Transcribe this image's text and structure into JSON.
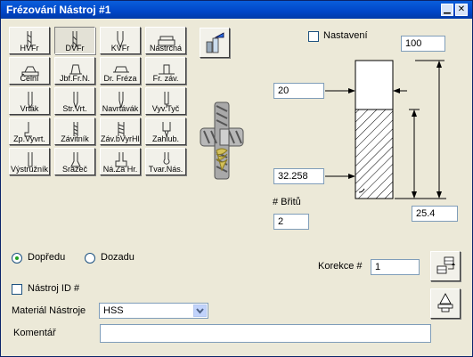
{
  "window": {
    "title": "Frézování Nástroj #1"
  },
  "tool_buttons": [
    {
      "label": "HVFr",
      "pressed": false
    },
    {
      "label": "DVFr",
      "pressed": true
    },
    {
      "label": "KVFr",
      "pressed": false
    },
    {
      "label": "Nástrčná",
      "pressed": false
    },
    {
      "label": "Čelní",
      "pressed": false
    },
    {
      "label": "Jbf.Fr.N.",
      "pressed": false
    },
    {
      "label": "Dr. Fréza",
      "pressed": false
    },
    {
      "label": "Fr. záv.",
      "pressed": false
    },
    {
      "label": "Vrták",
      "pressed": false
    },
    {
      "label": "Str.Vrt.",
      "pressed": false
    },
    {
      "label": "Navrtávák",
      "pressed": false
    },
    {
      "label": "Vyv.Tyč",
      "pressed": false
    },
    {
      "label": "Zp.Vyvrt.",
      "pressed": false
    },
    {
      "label": "Závitník",
      "pressed": false
    },
    {
      "label": "Záv.bVyrHlav",
      "pressed": false
    },
    {
      "label": "Zahlub.",
      "pressed": false
    },
    {
      "label": "Výstružník",
      "pressed": false
    },
    {
      "label": "Srážeč",
      "pressed": false
    },
    {
      "label": "Ná.Za Hr.",
      "pressed": false
    },
    {
      "label": "Tvar.Nás.",
      "pressed": false
    }
  ],
  "nastaveni": {
    "label": "Nastavení",
    "checked": false
  },
  "dims": {
    "overall_length": "100",
    "diameter": "20",
    "flute_length": "32.258",
    "corner": "25.4"
  },
  "flutes": {
    "label": "# Břitů",
    "value": "2"
  },
  "direction": {
    "forward": "Dopředu",
    "backward": "Dozadu",
    "selected": "forward"
  },
  "korekce": {
    "label": "Korekce #",
    "value": "1"
  },
  "tool_id": {
    "label": "Nástroj ID #",
    "checked": false
  },
  "material": {
    "label": "Materiál Nástroje",
    "value": "HSS"
  },
  "comment": {
    "label": "Komentář",
    "value": ""
  },
  "icons": [
    "minimize-icon",
    "close-icon",
    "library-icon",
    "insert-table-icon",
    "cone-icon"
  ]
}
